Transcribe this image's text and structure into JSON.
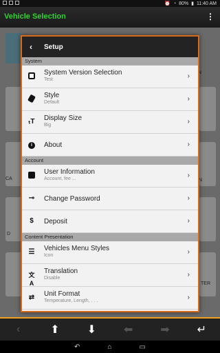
{
  "statusbar": {
    "battery": "80%",
    "time": "11:40 AM"
  },
  "appbar": {
    "title": "Vehicle Selection",
    "overflow_icon": "more-vert-icon"
  },
  "background": {
    "labels": [
      "CA",
      "N",
      "D",
      "TER",
      "N"
    ]
  },
  "dialog": {
    "back_icon": "‹",
    "title": "Setup",
    "sections": [
      {
        "label": "System",
        "items": [
          {
            "icon": "system-version-icon",
            "label": "System Version Selection",
            "sub": "Test"
          },
          {
            "icon": "style-icon",
            "label": "Style",
            "sub": "Default"
          },
          {
            "icon": "text-size-icon",
            "label": "Display Size",
            "sub": "Big"
          },
          {
            "icon": "info-icon",
            "label": "About",
            "sub": ""
          }
        ]
      },
      {
        "label": "Account",
        "items": [
          {
            "icon": "account-box-icon",
            "label": "User Information",
            "sub": "Account, fee ..."
          },
          {
            "icon": "key-icon",
            "label": "Change Password",
            "sub": ""
          },
          {
            "icon": "dollar-icon",
            "label": "Deposit",
            "sub": ""
          }
        ]
      },
      {
        "label": "Content Presentation",
        "items": [
          {
            "icon": "list-icon",
            "label": "Vehicles Menu Styles",
            "sub": "Icon"
          },
          {
            "icon": "translate-icon",
            "label": "Translation",
            "sub": "Disable"
          },
          {
            "icon": "swap-icon",
            "label": "Unit Format",
            "sub": "Temperature, Length, . . ."
          }
        ]
      }
    ]
  },
  "toolbar": {
    "buttons": [
      {
        "name": "prev-icon",
        "glyph": "‹",
        "enabled": false
      },
      {
        "name": "arrow-up-icon",
        "glyph": "⬆",
        "enabled": true
      },
      {
        "name": "arrow-down-icon",
        "glyph": "⬇",
        "enabled": true
      },
      {
        "name": "arrow-left-icon",
        "glyph": "⬅",
        "enabled": false
      },
      {
        "name": "arrow-right-icon",
        "glyph": "➡",
        "enabled": false
      },
      {
        "name": "enter-icon",
        "glyph": "↵",
        "enabled": true
      }
    ]
  },
  "sysnav": {
    "back": "↶",
    "home": "⌂",
    "recents": "▭"
  },
  "colors": {
    "title_green": "#34d134",
    "accent_orange": "#d96a1a"
  }
}
